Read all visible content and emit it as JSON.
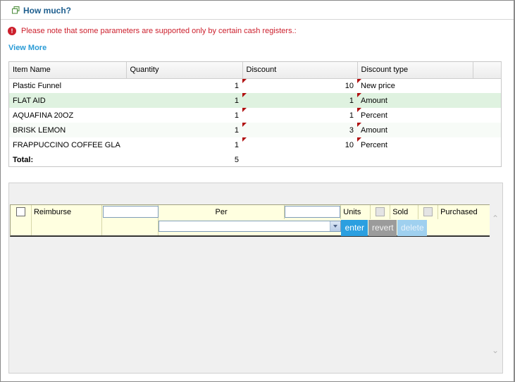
{
  "header": {
    "title": "How much?",
    "icon": "window-icon"
  },
  "warning": {
    "text": "Please note that some parameters are supported only by certain cash registers.:",
    "icon": "alert-icon",
    "color": "#cc1f2c"
  },
  "view_more": "View More",
  "grid": {
    "columns": [
      "Item Name",
      "Quantity",
      "Discount",
      "Discount type",
      ""
    ],
    "rows": [
      {
        "name": "Plastic Funnel",
        "quantity": "1",
        "discount": "10",
        "type": "New price"
      },
      {
        "name": "FLAT AID",
        "quantity": "1",
        "discount": "1",
        "type": "Amount"
      },
      {
        "name": "AQUAFINA 20OZ",
        "quantity": "1",
        "discount": "1",
        "type": "Percent"
      },
      {
        "name": "BRISK LEMON",
        "quantity": "1",
        "discount": "3",
        "type": "Amount"
      },
      {
        "name": "FRAPPUCCINO COFFEE GLA",
        "quantity": "1",
        "discount": "10",
        "type": "Percent"
      }
    ],
    "total_label": "Total:",
    "total_quantity": "5"
  },
  "form": {
    "reimburse_label": "Reimburse",
    "reimburse_value": "",
    "per_label": "Per",
    "per_value": "",
    "units_label": "Units",
    "sold_label": "Sold",
    "purchased_label": "Purchased",
    "select_value": "",
    "enter_label": "enter",
    "revert_label": "revert",
    "delete_label": "delete"
  },
  "colors": {
    "accent": "#2b9fe0",
    "title": "#1d5e8e",
    "link": "#2a9bd6",
    "selected_row": "#dff2e0"
  }
}
